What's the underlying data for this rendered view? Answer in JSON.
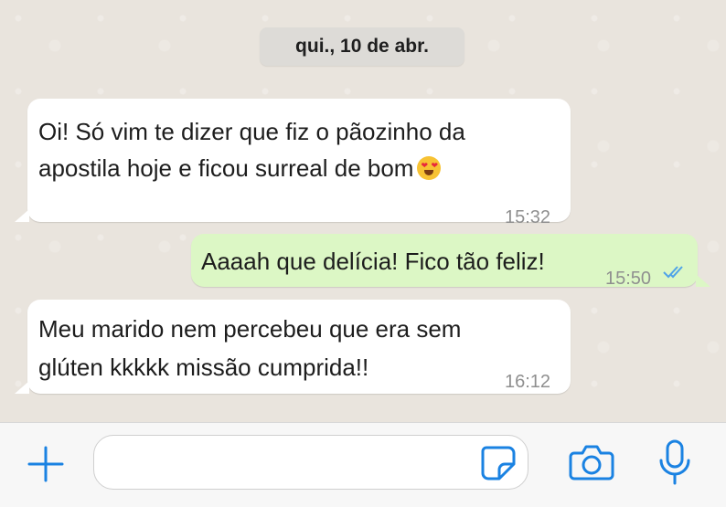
{
  "date_chip": "qui., 10 de abr.",
  "messages": [
    {
      "direction": "incoming",
      "line1": "Oi! Só vim te dizer que fiz o pãozinho da",
      "line2": "apostila hoje e ficou surreal de bom",
      "emoji": "heart-eyes-emoji",
      "time": "15:32"
    },
    {
      "direction": "outgoing",
      "text": "Aaaah que delícia! Fico tão feliz!",
      "time": "15:50",
      "status": "read"
    },
    {
      "direction": "incoming",
      "line1": "Meu marido nem percebeu que era sem",
      "line2": "glúten kkkkk missão cumprida!!",
      "time": "16:12"
    }
  ],
  "input_bar": {
    "icons": [
      "plus-icon",
      "sticker-icon",
      "camera-icon",
      "microphone-icon"
    ],
    "accent_color": "#1a82e2"
  },
  "colors": {
    "incoming_bubble": "#ffffff",
    "outgoing_bubble": "#dcf7c5",
    "chat_background": "#e9e4dd",
    "read_ticks": "#4fa3e8"
  }
}
